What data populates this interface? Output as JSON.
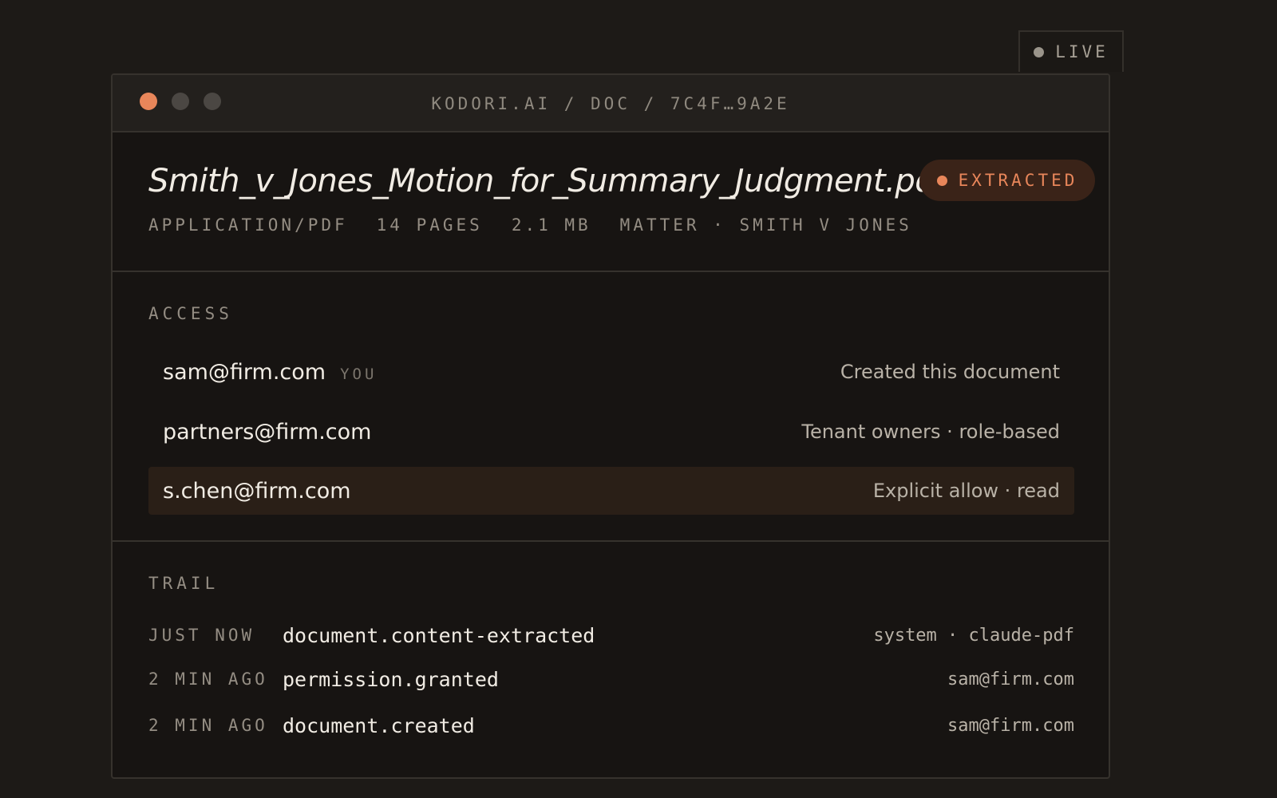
{
  "live_badge": {
    "label": "LIVE"
  },
  "window": {
    "path": "KODORI.AI / DOC / 7C4F…9A2E"
  },
  "document": {
    "filename": "Smith_v_Jones_Motion_for_Summary_Judgment.pdf",
    "status": "EXTRACTED",
    "meta": {
      "mime": "APPLICATION/PDF",
      "pages": "14 PAGES",
      "size": "2.1 MB",
      "matter": "MATTER · SMITH V JONES"
    }
  },
  "access": {
    "label": "ACCESS",
    "entries": [
      {
        "email": "sam@firm.com",
        "tag": "YOU",
        "description": "Created this document"
      },
      {
        "email": "partners@firm.com",
        "tag": "",
        "description": "Tenant owners · role-based"
      },
      {
        "email": "s.chen@firm.com",
        "tag": "",
        "description": "Explicit allow · read"
      }
    ]
  },
  "trail": {
    "label": "TRAIL",
    "events": [
      {
        "time": "JUST NOW",
        "event": "document.content-extracted",
        "actor": "system · claude-pdf"
      },
      {
        "time": "2 MIN AGO",
        "event": "permission.granted",
        "actor": "sam@firm.com"
      },
      {
        "time": "2 MIN AGO",
        "event": "document.created",
        "actor": "sam@firm.com"
      }
    ]
  },
  "colors": {
    "accent": "#e8865a",
    "background": "#1d1a17",
    "panel": "#171412",
    "highlight_row": "#2a1f17"
  }
}
